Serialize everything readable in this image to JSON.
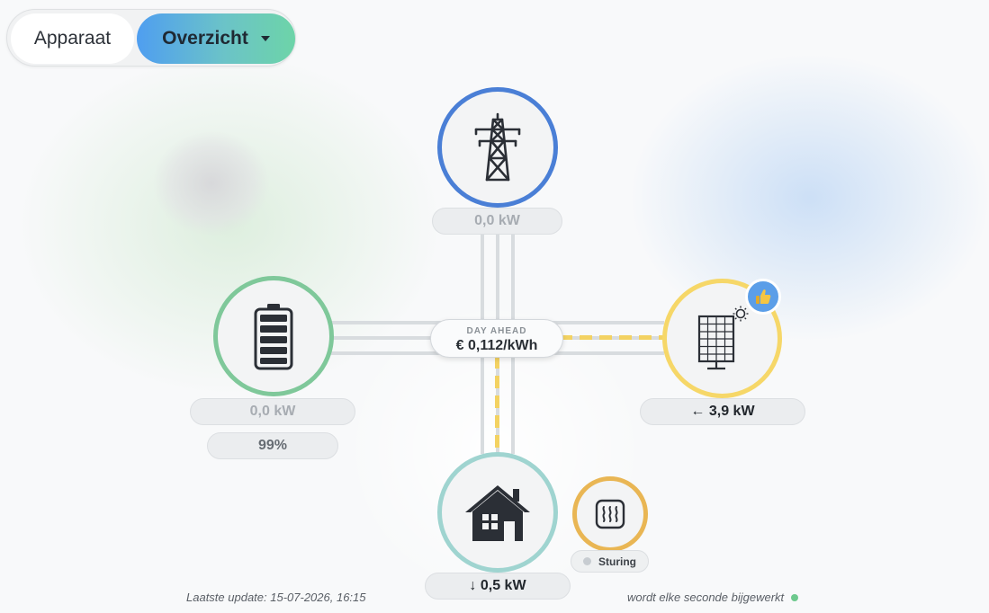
{
  "view_toggle": {
    "device_label": "Apparaat",
    "overview_label": "Overzicht",
    "selected": "Overzicht"
  },
  "grid": {
    "power": "0,0 kW",
    "icon": "power-tower-icon",
    "color": "#4a7fd6"
  },
  "battery": {
    "power": "0,0 kW",
    "soc": "99%",
    "icon": "battery-icon",
    "color": "#7fc89a"
  },
  "solar": {
    "power": "← 3,9 kW",
    "icon": "solar-panel-icon",
    "badge_icon": "thumbs-up-icon",
    "color": "#f6d768"
  },
  "house": {
    "power": "↓ 0,5 kW",
    "icon": "house-icon",
    "color": "#9fd4d0"
  },
  "heater": {
    "icon": "heater-icon",
    "label": "Sturing",
    "color": "#e9b654"
  },
  "price": {
    "label": "DAY AHEAD",
    "value": "€ 0,112/kWh"
  },
  "flow_color": "#f3d262",
  "footer": {
    "last_update": "Laatste update: 15-07-2026, 16:15",
    "refresh_note": "wordt elke seconde bijgewerkt"
  }
}
